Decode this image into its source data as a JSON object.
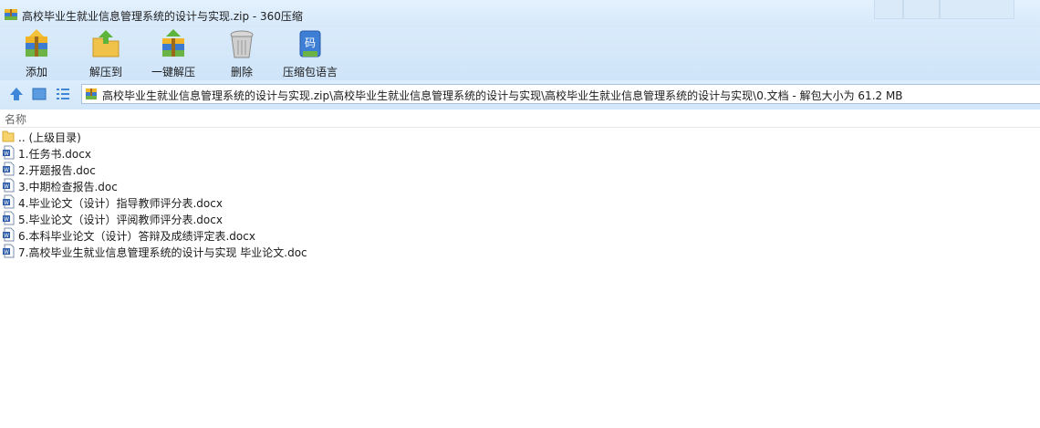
{
  "window": {
    "title": "高校毕业生就业信息管理系统的设计与实现.zip - 360压缩"
  },
  "toolbar": {
    "buttons": [
      {
        "label": "添加",
        "icon": "add-archive-icon"
      },
      {
        "label": "解压到",
        "icon": "extract-to-icon"
      },
      {
        "label": "一键解压",
        "icon": "one-click-extract-icon"
      },
      {
        "label": "删除",
        "icon": "delete-icon"
      },
      {
        "label": "压缩包语言",
        "icon": "archive-language-icon"
      }
    ]
  },
  "navbar": {
    "icons": [
      "up-arrow-icon",
      "thumbnail-view-icon",
      "list-view-icon"
    ],
    "address": "高校毕业生就业信息管理系统的设计与实现.zip\\高校毕业生就业信息管理系统的设计与实现\\高校毕业生就业信息管理系统的设计与实现\\0.文档 - 解包大小为 61.2 MB"
  },
  "columns": {
    "name": "名称"
  },
  "files": [
    {
      "name": ".. (上级目录)",
      "type": "folder"
    },
    {
      "name": "1.任务书.docx",
      "type": "word"
    },
    {
      "name": "2.开题报告.doc",
      "type": "word"
    },
    {
      "name": "3.中期检查报告.doc",
      "type": "word"
    },
    {
      "name": "4.毕业论文（设计）指导教师评分表.docx",
      "type": "word"
    },
    {
      "name": "5.毕业论文（设计）评阅教师评分表.docx",
      "type": "word"
    },
    {
      "name": "6.本科毕业论文（设计）答辩及成绩评定表.docx",
      "type": "word"
    },
    {
      "name": "7.高校毕业生就业信息管理系统的设计与实现 毕业论文.doc",
      "type": "word"
    }
  ],
  "colors": {
    "toolbar_bg": "#d9ebfb",
    "address_border": "#a9c3df",
    "word_icon_blue": "#2a5aa8"
  }
}
